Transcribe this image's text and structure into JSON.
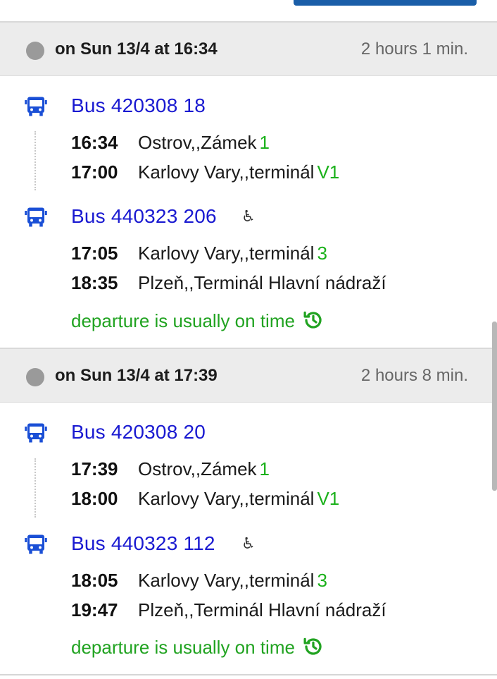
{
  "connections": [
    {
      "when": "on Sun 13/4 at 16:34",
      "duration": "2 hours 1 min.",
      "legs": [
        {
          "line": "Bus 420308 18",
          "wheelchair": false,
          "stops": [
            {
              "time": "16:34",
              "name": "Ostrov,,Zámek",
              "platform": "1"
            },
            {
              "time": "17:00",
              "name": "Karlovy Vary,,terminál",
              "platform": "V1"
            }
          ]
        },
        {
          "line": "Bus 440323 206",
          "wheelchair": true,
          "wheelchair_icon": "wheelchair-icon",
          "stops": [
            {
              "time": "17:05",
              "name": "Karlovy Vary,,terminál",
              "platform": "3"
            },
            {
              "time": "18:35",
              "name": "Plzeň,,Terminál Hlavní nádraží",
              "platform": ""
            }
          ]
        }
      ],
      "status": "departure is usually on time",
      "status_icon": "history-icon"
    },
    {
      "when": "on Sun 13/4 at 17:39",
      "duration": "2 hours 8 min.",
      "legs": [
        {
          "line": "Bus 420308 20",
          "wheelchair": false,
          "stops": [
            {
              "time": "17:39",
              "name": "Ostrov,,Zámek",
              "platform": "1"
            },
            {
              "time": "18:00",
              "name": "Karlovy Vary,,terminál",
              "platform": "V1"
            }
          ]
        },
        {
          "line": "Bus 440323 112",
          "wheelchair": true,
          "wheelchair_icon": "wheelchair-icon",
          "stops": [
            {
              "time": "18:05",
              "name": "Karlovy Vary,,terminál",
              "platform": "3"
            },
            {
              "time": "19:47",
              "name": "Plzeň,,Terminál Hlavní nádraží",
              "platform": ""
            }
          ]
        }
      ],
      "status": "departure is usually on time",
      "status_icon": "history-icon"
    }
  ],
  "colors": {
    "line_title": "#1a1ad1",
    "platform": "#1bb11b",
    "status": "#21a321",
    "header_bg": "#ececec",
    "bus_icon": "#1a4fd6"
  }
}
